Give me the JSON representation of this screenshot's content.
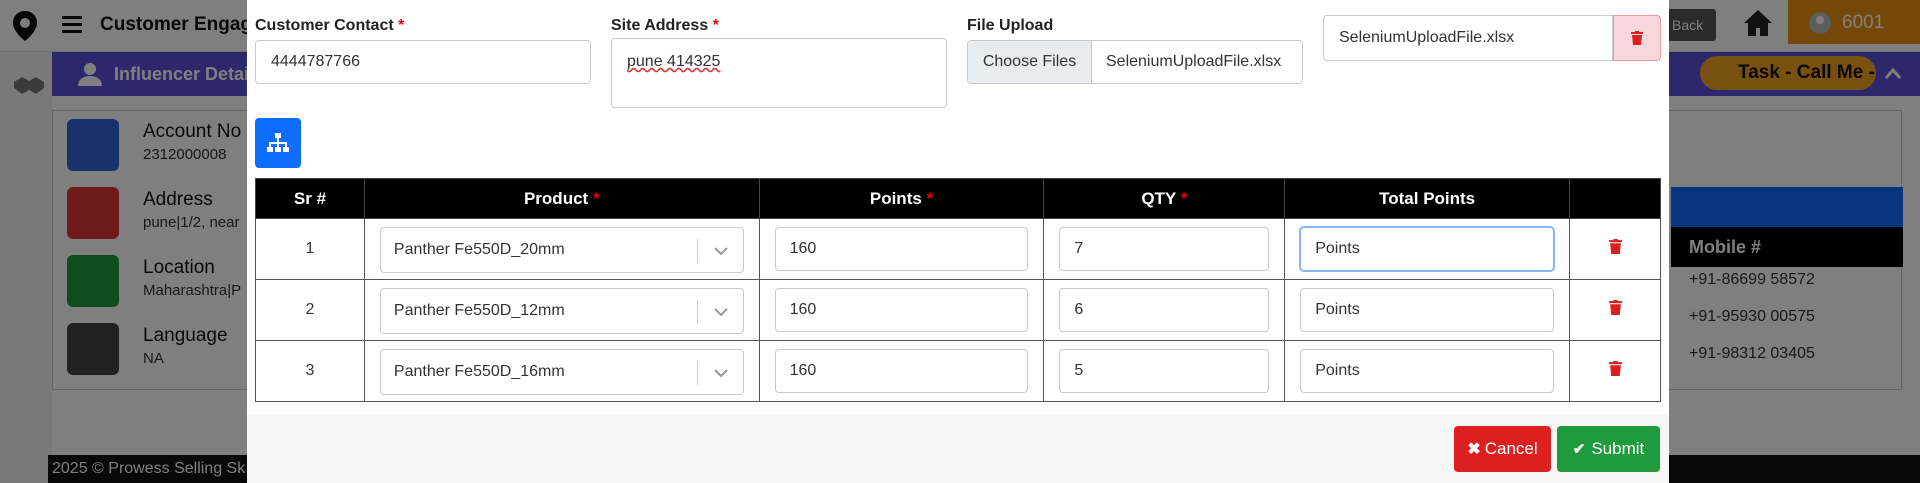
{
  "background": {
    "app_title": "Customer Engage",
    "go_back": "Back",
    "user_id": "6001",
    "subheader": "Influencer Detail",
    "task_chip": "Task - Call Me - (",
    "cards": [
      {
        "label": "Account No",
        "value": "2312000008",
        "icon": "book-icon",
        "color": "#3465d9"
      },
      {
        "label": "Address",
        "value": "pune|1/2, near",
        "icon": "home-icon",
        "color": "#d93434"
      },
      {
        "label": "Location",
        "value": "Maharashtra|P",
        "icon": "location-icon",
        "color": "#1f9a3c"
      },
      {
        "label": "Language",
        "value": "NA",
        "icon": "translate-icon",
        "color": "#444444"
      }
    ],
    "mobile_header": "Mobile #",
    "mobiles": [
      "+91-86699 58572",
      "+91-95930 00575",
      "+91-98312 03405"
    ],
    "footer": "2025 © Prowess Selling Sk"
  },
  "modal": {
    "customer_contact": {
      "label": "Customer Contact",
      "value": "4444787766"
    },
    "site_address": {
      "label": "Site Address",
      "value": "pune 414325"
    },
    "file_upload": {
      "label": "File Upload",
      "button": "Choose Files",
      "filename": "SeleniumUploadFile.xlsx"
    },
    "uploaded_file": "SeleniumUploadFile.xlsx",
    "table": {
      "headers": {
        "sr": "Sr #",
        "product": "Product",
        "points": "Points",
        "qty": "QTY",
        "total": "Total Points"
      },
      "rows": [
        {
          "sr": "1",
          "product": "Panther Fe550D_20mm",
          "points": "160",
          "qty": "7",
          "total_placeholder": "Points"
        },
        {
          "sr": "2",
          "product": "Panther Fe550D_12mm",
          "points": "160",
          "qty": "6",
          "total_placeholder": "Points"
        },
        {
          "sr": "3",
          "product": "Panther Fe550D_16mm",
          "points": "160",
          "qty": "5",
          "total_placeholder": "Points"
        }
      ]
    },
    "cancel_label": "Cancel",
    "submit_label": "Submit"
  },
  "colors": {
    "primary": "#0d6efd",
    "danger": "#dc1f1f",
    "success": "#1f9a3c",
    "header_bg": "#000000",
    "brand_purple": "#5b4fd6",
    "orange": "#e8900c"
  }
}
